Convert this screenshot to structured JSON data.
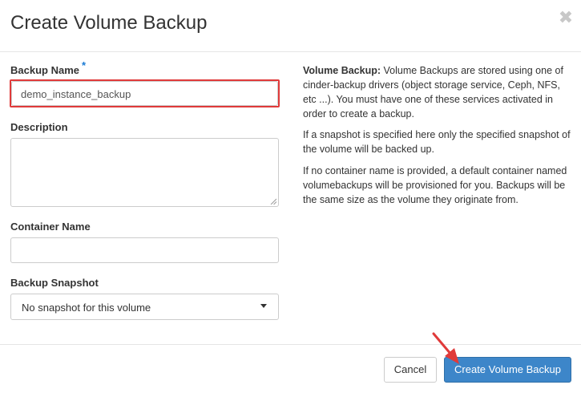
{
  "modal": {
    "title": "Create Volume Backup",
    "close_symbol": "✖",
    "close_icon": "close-icon"
  },
  "form": {
    "backup_name": {
      "label": "Backup Name",
      "required_mark": "*",
      "value": "demo_instance_backup"
    },
    "description": {
      "label": "Description",
      "value": ""
    },
    "container_name": {
      "label": "Container Name",
      "value": ""
    },
    "backup_snapshot": {
      "label": "Backup Snapshot",
      "selected": "No snapshot for this volume"
    }
  },
  "help": {
    "heading": "Volume Backup:",
    "p1": " Volume Backups are stored using one of cinder-backup drivers (object storage service, Ceph, NFS, etc ...). You must have one of these services activated in order to create a backup.",
    "p2": "If a snapshot is specified here only the specified snapshot of the volume will be backed up.",
    "p3": "If no container name is provided, a default container named volumebackups will be provisioned for you. Backups will be the same size as the volume they originate from."
  },
  "footer": {
    "cancel_label": "Cancel",
    "submit_label": "Create Volume Backup"
  },
  "colors": {
    "primary": "#3d86c9",
    "highlight": "#e03a3a",
    "required": "#1a7ad4"
  }
}
